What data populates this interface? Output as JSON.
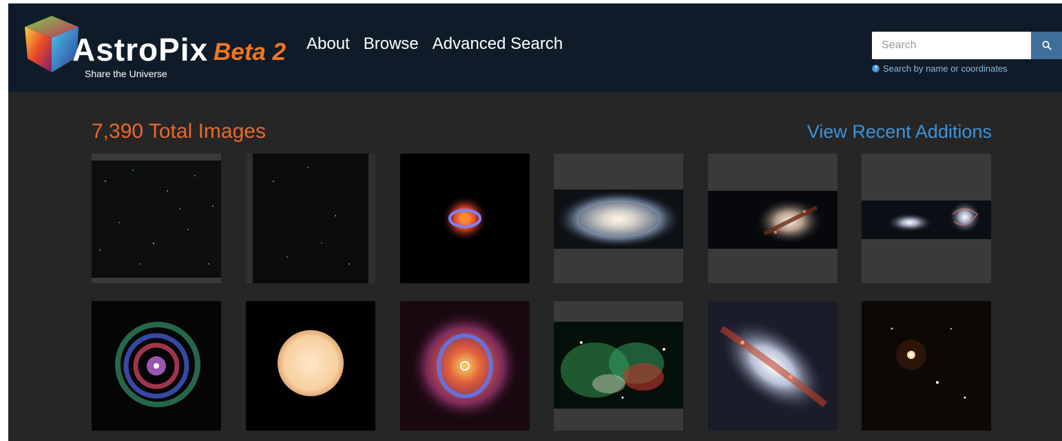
{
  "header": {
    "logo_text": "AstroPix",
    "beta_label": "Beta 2",
    "tagline": "Share the Universe",
    "nav": [
      "About",
      "Browse",
      "Advanced Search"
    ],
    "search": {
      "placeholder": "Search",
      "value": "",
      "help_text": "Search by name or coordinates",
      "button_icon": "search-icon"
    }
  },
  "main": {
    "total_images": "7,390 Total Images",
    "recent_link": "View Recent Additions"
  },
  "gallery": {
    "rows": [
      [
        "sparse-starfield",
        "dark-starfield",
        "ring-nebula-orange-core",
        "spiral-galaxy-face-on",
        "edge-on-dusty-galaxy",
        "interacting-galaxy-pair"
      ],
      [
        "multicolor-shell-nebula",
        "peach-glowing-disk",
        "blue-ring-nebula",
        "green-red-dust-cloud",
        "starburst-galaxy",
        "star-with-faint-companions"
      ]
    ]
  },
  "colors": {
    "header_bg": "#0f1b28",
    "page_bg": "#262626",
    "accent_orange": "#e8692c",
    "link_blue": "#3d93d9",
    "search_button": "#3f6f98"
  }
}
